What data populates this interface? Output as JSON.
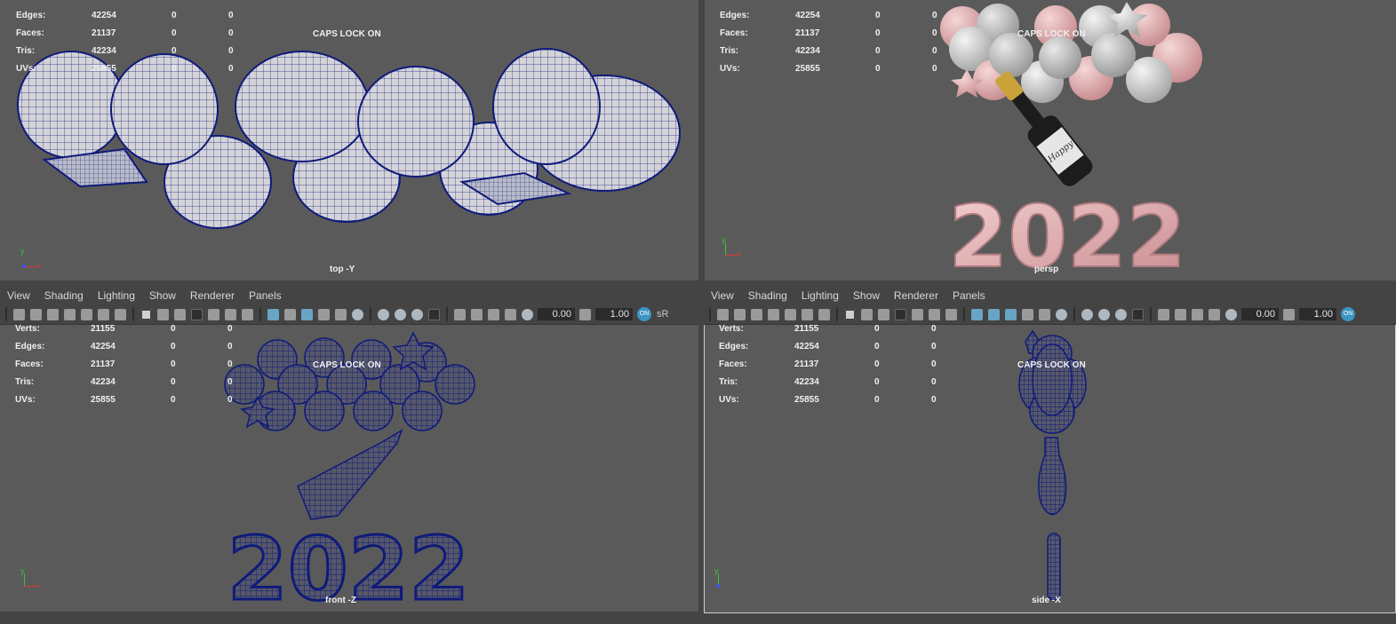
{
  "menu": [
    "View",
    "Shading",
    "Lighting",
    "Show",
    "Renderer",
    "Panels"
  ],
  "toolbar": {
    "near": "0.00",
    "far": "1.00",
    "color_mode": "sR"
  },
  "stats": {
    "labels": [
      "Verts:",
      "Edges:",
      "Faces:",
      "Tris:",
      "UVs:"
    ],
    "col1": [
      "21155",
      "42254",
      "21137",
      "42234",
      "25855"
    ],
    "col2": [
      "0",
      "0",
      "0",
      "0",
      "0"
    ],
    "col3": [
      "0",
      "0",
      "0",
      "0",
      "0"
    ],
    "top_partial_verts": "21155"
  },
  "caps_lock": "CAPS LOCK ON",
  "viewports": {
    "top": {
      "camera": "top -Y"
    },
    "persp": {
      "camera": "persp"
    },
    "front": {
      "camera": "front -Z"
    },
    "side": {
      "camera": "side -X"
    }
  },
  "scene_text": {
    "year": "2022",
    "bottle_label": "Happy"
  },
  "axis_labels": {
    "y": "y",
    "x": "x"
  },
  "colors": {
    "wire": "#0f1a7a",
    "viewport_bg": "#5a5a5a",
    "panel_bg": "#444444",
    "pink": "#e8b0b0",
    "silver": "#d6d6d6"
  }
}
